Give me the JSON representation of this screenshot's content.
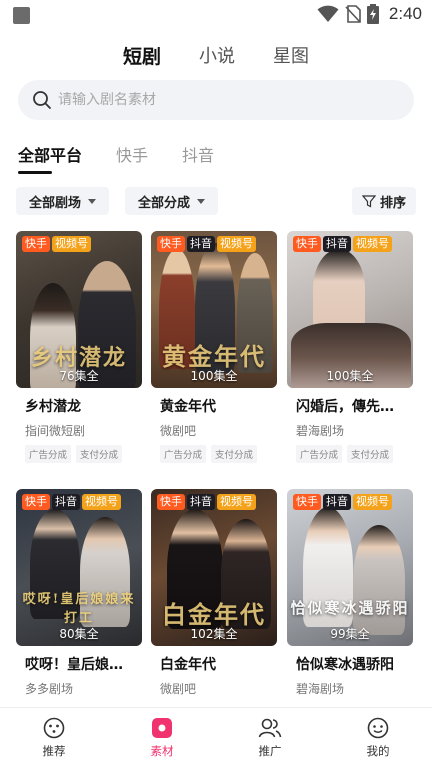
{
  "status_bar": {
    "time": "2:40"
  },
  "top_tabs": [
    {
      "label": "短剧",
      "active": true
    },
    {
      "label": "小说",
      "active": false
    },
    {
      "label": "星图",
      "active": false
    }
  ],
  "search": {
    "placeholder": "请输入剧名素材"
  },
  "platform_tabs": [
    {
      "label": "全部平台",
      "active": true
    },
    {
      "label": "快手",
      "active": false
    },
    {
      "label": "抖音",
      "active": false
    }
  ],
  "filters": {
    "theater": "全部剧场",
    "share": "全部分成",
    "sort": "排序"
  },
  "cards": [
    {
      "tags": [
        "快手",
        "视频号"
      ],
      "episodes": "76集全",
      "title": "乡村潜龙",
      "subtitle": "指间微短剧",
      "chips": [
        "广告分成",
        "支付分成"
      ],
      "poster_text": "乡村潜龙"
    },
    {
      "tags": [
        "快手",
        "抖音",
        "视频号"
      ],
      "episodes": "100集全",
      "title": "黄金年代",
      "subtitle": "微剧吧",
      "chips": [
        "广告分成",
        "支付分成"
      ],
      "poster_text": "黄金年代"
    },
    {
      "tags": [
        "快手",
        "抖音",
        "视频号"
      ],
      "episodes": "100集全",
      "title": "闪婚后，傳先…",
      "subtitle": "碧海剧场",
      "chips": [
        "广告分成",
        "支付分成"
      ],
      "poster_text": ""
    },
    {
      "tags": [
        "快手",
        "抖音",
        "视频号"
      ],
      "episodes": "80集全",
      "title": "哎呀！皇后娘…",
      "subtitle": "多多剧场",
      "chips": [],
      "poster_text": "哎呀!皇后娘娘来打工"
    },
    {
      "tags": [
        "快手",
        "抖音",
        "视频号"
      ],
      "episodes": "102集全",
      "title": "白金年代",
      "subtitle": "微剧吧",
      "chips": [],
      "poster_text": "白金年代"
    },
    {
      "tags": [
        "快手",
        "抖音",
        "视频号"
      ],
      "episodes": "99集全",
      "title": "恰似寒冰遇骄阳",
      "subtitle": "碧海剧场",
      "chips": [],
      "poster_text": "恰似寒冰遇骄阳"
    }
  ],
  "bottom_nav": [
    {
      "label": "推荐",
      "icon": "compass-icon",
      "active": false
    },
    {
      "label": "素材",
      "icon": "material-icon",
      "active": true
    },
    {
      "label": "推广",
      "icon": "users-icon",
      "active": false
    },
    {
      "label": "我的",
      "icon": "face-icon",
      "active": false
    }
  ],
  "colors": {
    "accent": "#f0336f",
    "kuaishou": "#ff5a1f",
    "douyin": "#1c1c22",
    "shipinhao": "#f5a21b"
  }
}
